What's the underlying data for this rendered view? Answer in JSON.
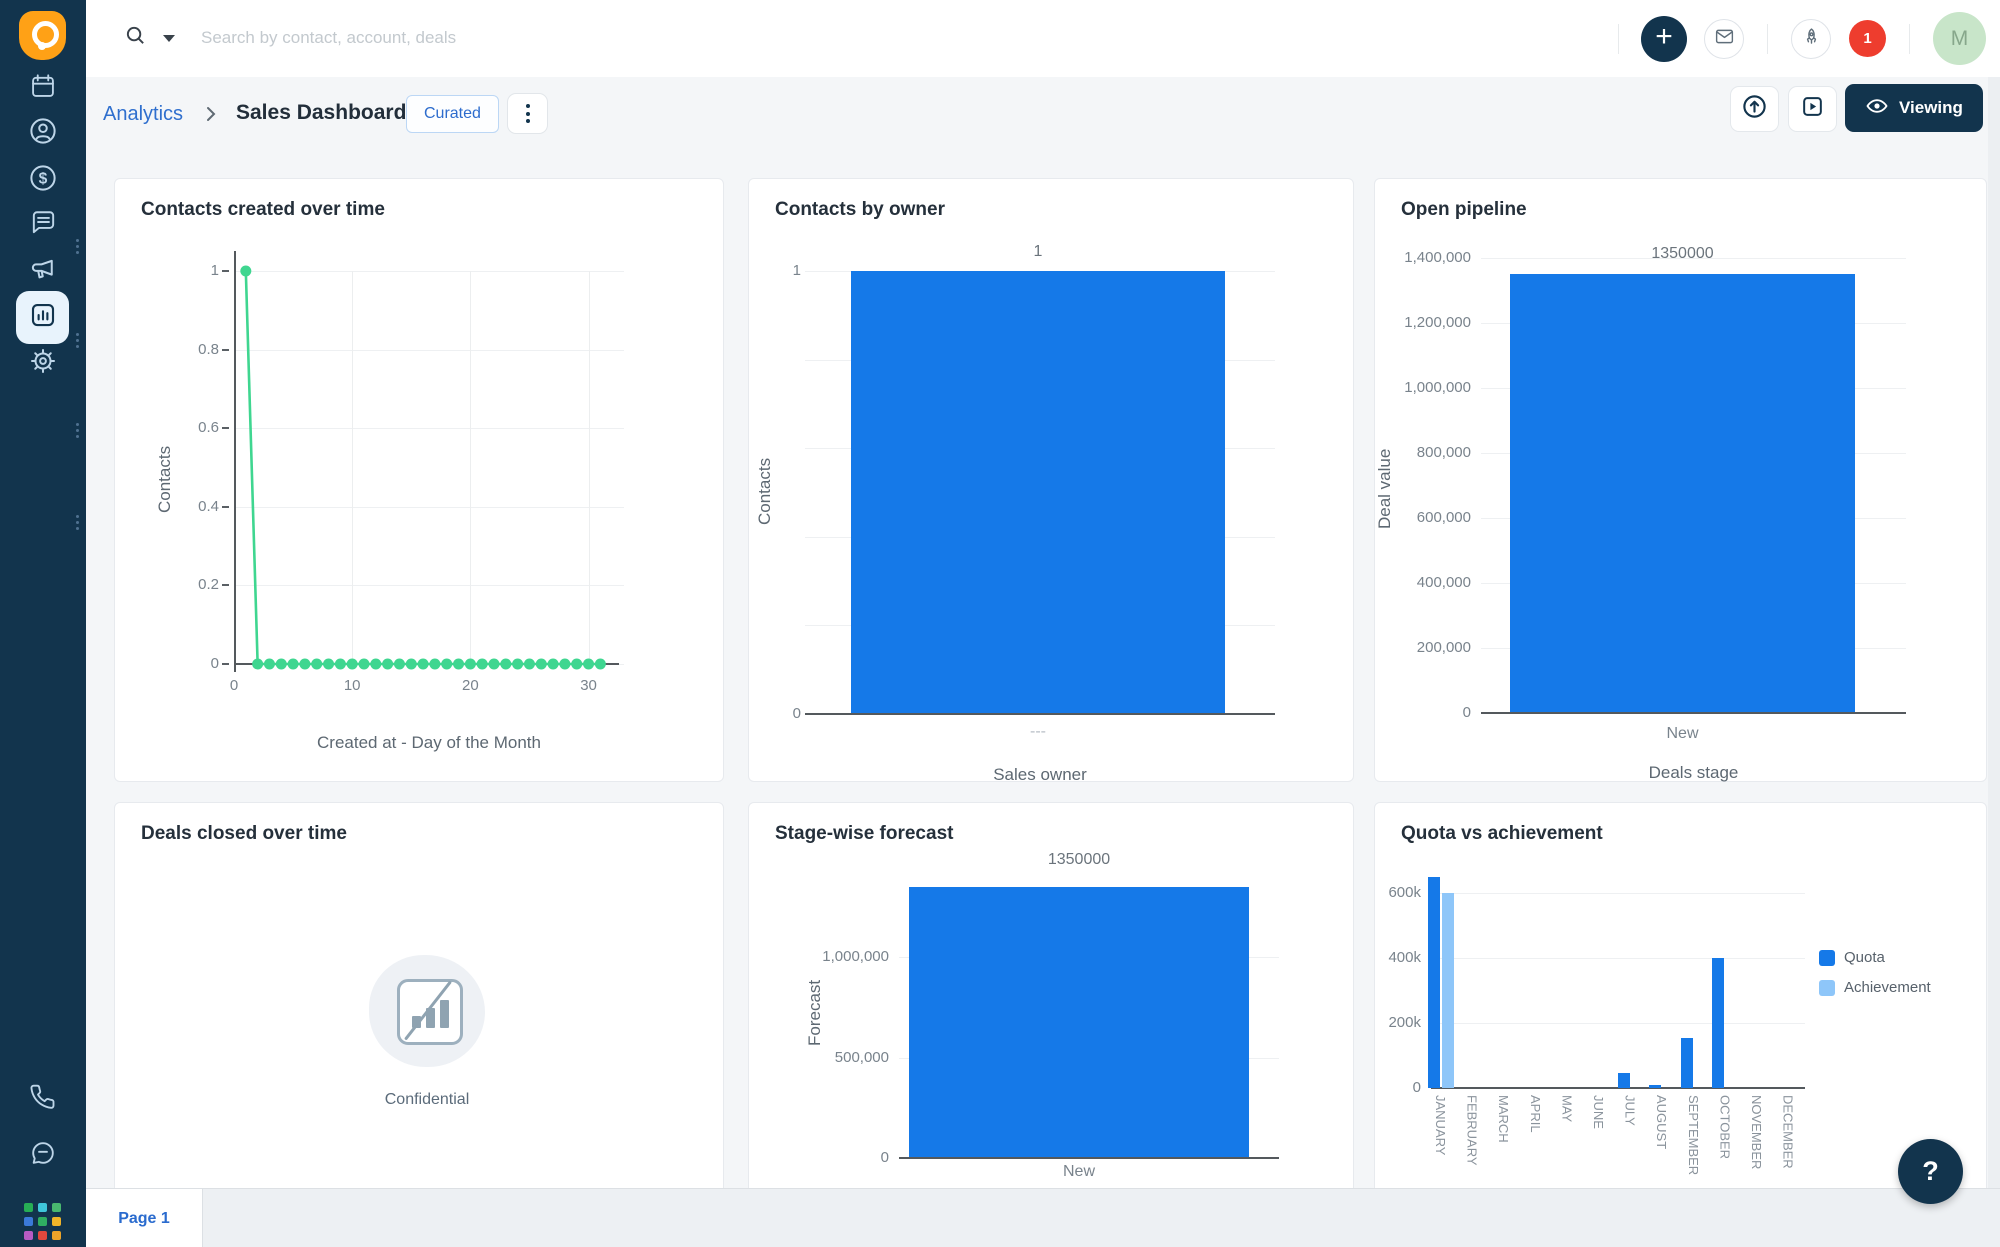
{
  "topbar": {
    "search_placeholder": "Search by contact, account, deals",
    "notification_count": "1",
    "avatar_initial": "M",
    "plus_label": "+"
  },
  "breadcrumb": {
    "parent": "Analytics",
    "current": "Sales Dashboard",
    "badge": "Curated"
  },
  "actions": {
    "viewing_label": "Viewing"
  },
  "footer": {
    "page_tab": "Page 1",
    "help_label": "?"
  },
  "colors": {
    "accent_blue": "#1579e8",
    "accent_blue_light": "#8ec6f9",
    "line_green": "#3fd690",
    "navy": "#12344d",
    "link_blue": "#2f6fce",
    "badge_red": "#ee3d2e",
    "avatar_green": "#c8e5c9"
  },
  "chart_data": [
    {
      "id": "contacts-created-over-time",
      "type": "line",
      "title": "Contacts created over time",
      "xlabel": "Created at - Day of the Month",
      "ylabel": "Contacts",
      "x_ticks": [
        0,
        10,
        20,
        30
      ],
      "y_ticks": [
        1,
        0.8,
        0.6,
        0.4,
        0.2,
        0
      ],
      "xlim": [
        0,
        33
      ],
      "ylim": [
        0,
        1
      ],
      "x": [
        1,
        2,
        3,
        4,
        5,
        6,
        7,
        8,
        9,
        10,
        11,
        12,
        13,
        14,
        15,
        16,
        17,
        18,
        19,
        20,
        21,
        22,
        23,
        24,
        25,
        26,
        27,
        28,
        29,
        30,
        31
      ],
      "values": [
        1,
        0,
        0,
        0,
        0,
        0,
        0,
        0,
        0,
        0,
        0,
        0,
        0,
        0,
        0,
        0,
        0,
        0,
        0,
        0,
        0,
        0,
        0,
        0,
        0,
        0,
        0,
        0,
        0,
        0,
        0
      ],
      "line_color": "#3fd690",
      "grid": true
    },
    {
      "id": "contacts-by-owner",
      "type": "bar",
      "title": "Contacts by owner",
      "xlabel": "Sales owner",
      "ylabel": "Contacts",
      "categories": [
        "---"
      ],
      "values": [
        1
      ],
      "value_labels": [
        "1"
      ],
      "y_ticks": [
        {
          "value": 1,
          "label": "1"
        },
        {
          "value": 0,
          "label": "0"
        }
      ],
      "minor_grid_values": [
        0.8,
        0.6,
        0.4,
        0.2
      ],
      "ylim": [
        0,
        1
      ],
      "bar_color": "#1579e8"
    },
    {
      "id": "open-pipeline",
      "type": "bar",
      "title": "Open pipeline",
      "xlabel": "Deals stage",
      "ylabel": "Deal value",
      "categories": [
        "New"
      ],
      "values": [
        1350000
      ],
      "value_labels": [
        "1350000"
      ],
      "y_ticks": [
        {
          "value": 1400000,
          "label": "1,400,000"
        },
        {
          "value": 1200000,
          "label": "1,200,000"
        },
        {
          "value": 1000000,
          "label": "1,000,000"
        },
        {
          "value": 800000,
          "label": "800,000"
        },
        {
          "value": 600000,
          "label": "600,000"
        },
        {
          "value": 400000,
          "label": "400,000"
        },
        {
          "value": 200000,
          "label": "200,000"
        },
        {
          "value": 0,
          "label": "0"
        }
      ],
      "ylim": [
        0,
        1400000
      ],
      "bar_color": "#1579e8"
    },
    {
      "id": "deals-closed-over-time",
      "type": "empty",
      "title": "Deals closed over time",
      "message": "Confidential"
    },
    {
      "id": "stage-wise-forecast",
      "type": "bar",
      "title": "Stage-wise forecast",
      "xlabel": "",
      "ylabel": "Forecast",
      "categories": [
        "New"
      ],
      "values": [
        1350000
      ],
      "value_labels": [
        "1350000"
      ],
      "y_ticks": [
        {
          "value": 1000000,
          "label": "1,000,000"
        },
        {
          "value": 500000,
          "label": "500,000"
        },
        {
          "value": 0,
          "label": "0"
        }
      ],
      "ylim": [
        0,
        1400000
      ],
      "bar_color": "#1579e8"
    },
    {
      "id": "quota-vs-achievement",
      "type": "grouped_bar",
      "title": "Quota vs achievement",
      "categories": [
        "JANUARY",
        "FEBRUARY",
        "MARCH",
        "APRIL",
        "MAY",
        "JUNE",
        "JULY",
        "AUGUST",
        "SEPTEMBER",
        "OCTOBER",
        "NOVEMBER",
        "DECEMBER"
      ],
      "series": [
        {
          "name": "Quota",
          "color": "#1579e8",
          "values": [
            650000,
            0,
            0,
            0,
            0,
            0,
            45000,
            10000,
            155000,
            400000,
            0,
            0
          ]
        },
        {
          "name": "Achievement",
          "color": "#8ec6f9",
          "values": [
            600000,
            0,
            0,
            0,
            0,
            0,
            0,
            0,
            0,
            0,
            0,
            0
          ]
        }
      ],
      "y_ticks": [
        {
          "value": 600000,
          "label": "600k"
        },
        {
          "value": 400000,
          "label": "400k"
        },
        {
          "value": 200000,
          "label": "200k"
        },
        {
          "value": 0,
          "label": "0"
        }
      ],
      "ylim": [
        0,
        690000
      ],
      "legend_position": "right"
    }
  ]
}
